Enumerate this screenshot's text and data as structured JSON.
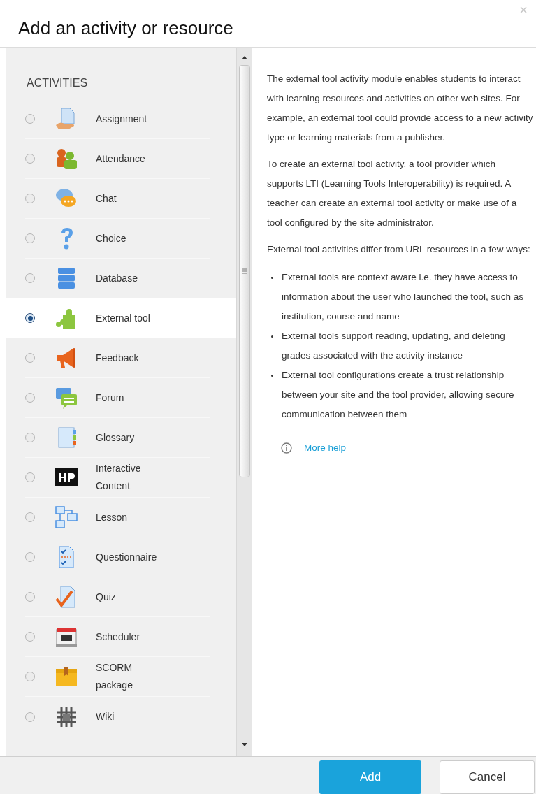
{
  "dialog": {
    "title": "Add an activity or resource",
    "close": "×"
  },
  "section": "ACTIVITIES",
  "activities": [
    {
      "label": "Assignment",
      "selected": false
    },
    {
      "label": "Attendance",
      "selected": false
    },
    {
      "label": "Chat",
      "selected": false
    },
    {
      "label": "Choice",
      "selected": false
    },
    {
      "label": "Database",
      "selected": false
    },
    {
      "label": "External tool",
      "selected": true
    },
    {
      "label": "Feedback",
      "selected": false
    },
    {
      "label": "Forum",
      "selected": false
    },
    {
      "label": "Glossary",
      "selected": false
    },
    {
      "label": "Interactive Content",
      "selected": false
    },
    {
      "label": "Lesson",
      "selected": false
    },
    {
      "label": "Questionnaire",
      "selected": false
    },
    {
      "label": "Quiz",
      "selected": false
    },
    {
      "label": "Scheduler",
      "selected": false
    },
    {
      "label": "SCORM package",
      "selected": false
    },
    {
      "label": "Wiki",
      "selected": false
    }
  ],
  "description": {
    "paragraphs": [
      "The external tool activity module enables students to interact with learning resources and activities on other web sites. For example, an external tool could provide access to a new activity type or learning materials from a publisher.",
      "To create an external tool activity, a tool provider which supports LTI (Learning Tools Interoperability) is required. A teacher can create an external tool activity or make use of a tool configured by the site administrator.",
      "External tool activities differ from URL resources in a few ways:"
    ],
    "bullets": [
      "External tools are context aware i.e. they have access to information about the user who launched the tool, such as institution, course and name",
      "External tools support reading, updating, and deleting grades associated with the activity instance",
      "External tool configurations create a trust relationship between your site and the tool provider, allowing secure communication between them"
    ],
    "help_link": "More help"
  },
  "buttons": {
    "primary": "Add",
    "secondary": "Cancel"
  }
}
